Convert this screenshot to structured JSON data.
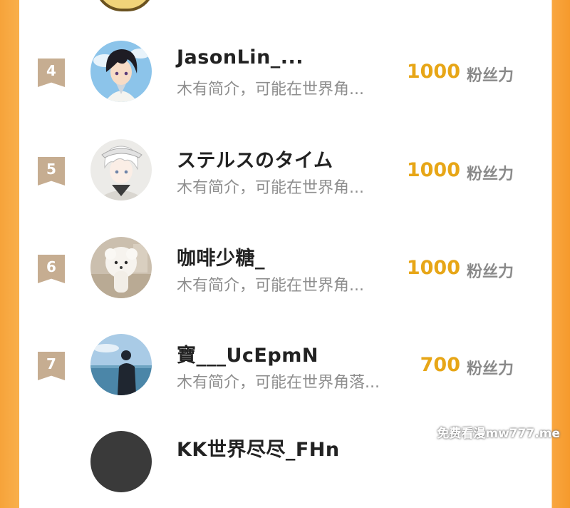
{
  "ranking": [
    {
      "rank": "4",
      "name": "JasonLin_...",
      "bio": "木有简介，可能在世界角...",
      "fans": "1000",
      "fans_label": "粉丝力",
      "avatar_icon": "anime-boy-avatar-icon"
    },
    {
      "rank": "5",
      "name": "ステルスのタイム",
      "bio": "木有简介，可能在世界角...",
      "fans": "1000",
      "fans_label": "粉丝力",
      "avatar_icon": "white-hair-anime-avatar-icon"
    },
    {
      "rank": "6",
      "name": "咖啡少糖_",
      "bio": "木有简介，可能在世界角...",
      "fans": "1000",
      "fans_label": "粉丝力",
      "avatar_icon": "fluffy-dog-avatar-icon"
    },
    {
      "rank": "7",
      "name": "寶___UcEpmN",
      "bio": "木有简介，可能在世界角落...",
      "fans": "700",
      "fans_label": "粉丝力",
      "avatar_icon": "seaside-silhouette-avatar-icon"
    },
    {
      "name": "KK世界尽尽_FHn"
    }
  ],
  "watermark": "免费看漫mw777.me",
  "colors": {
    "accent": "#e7a617",
    "frame": "#f6a33a",
    "rank_badge": "#c6ad91"
  }
}
